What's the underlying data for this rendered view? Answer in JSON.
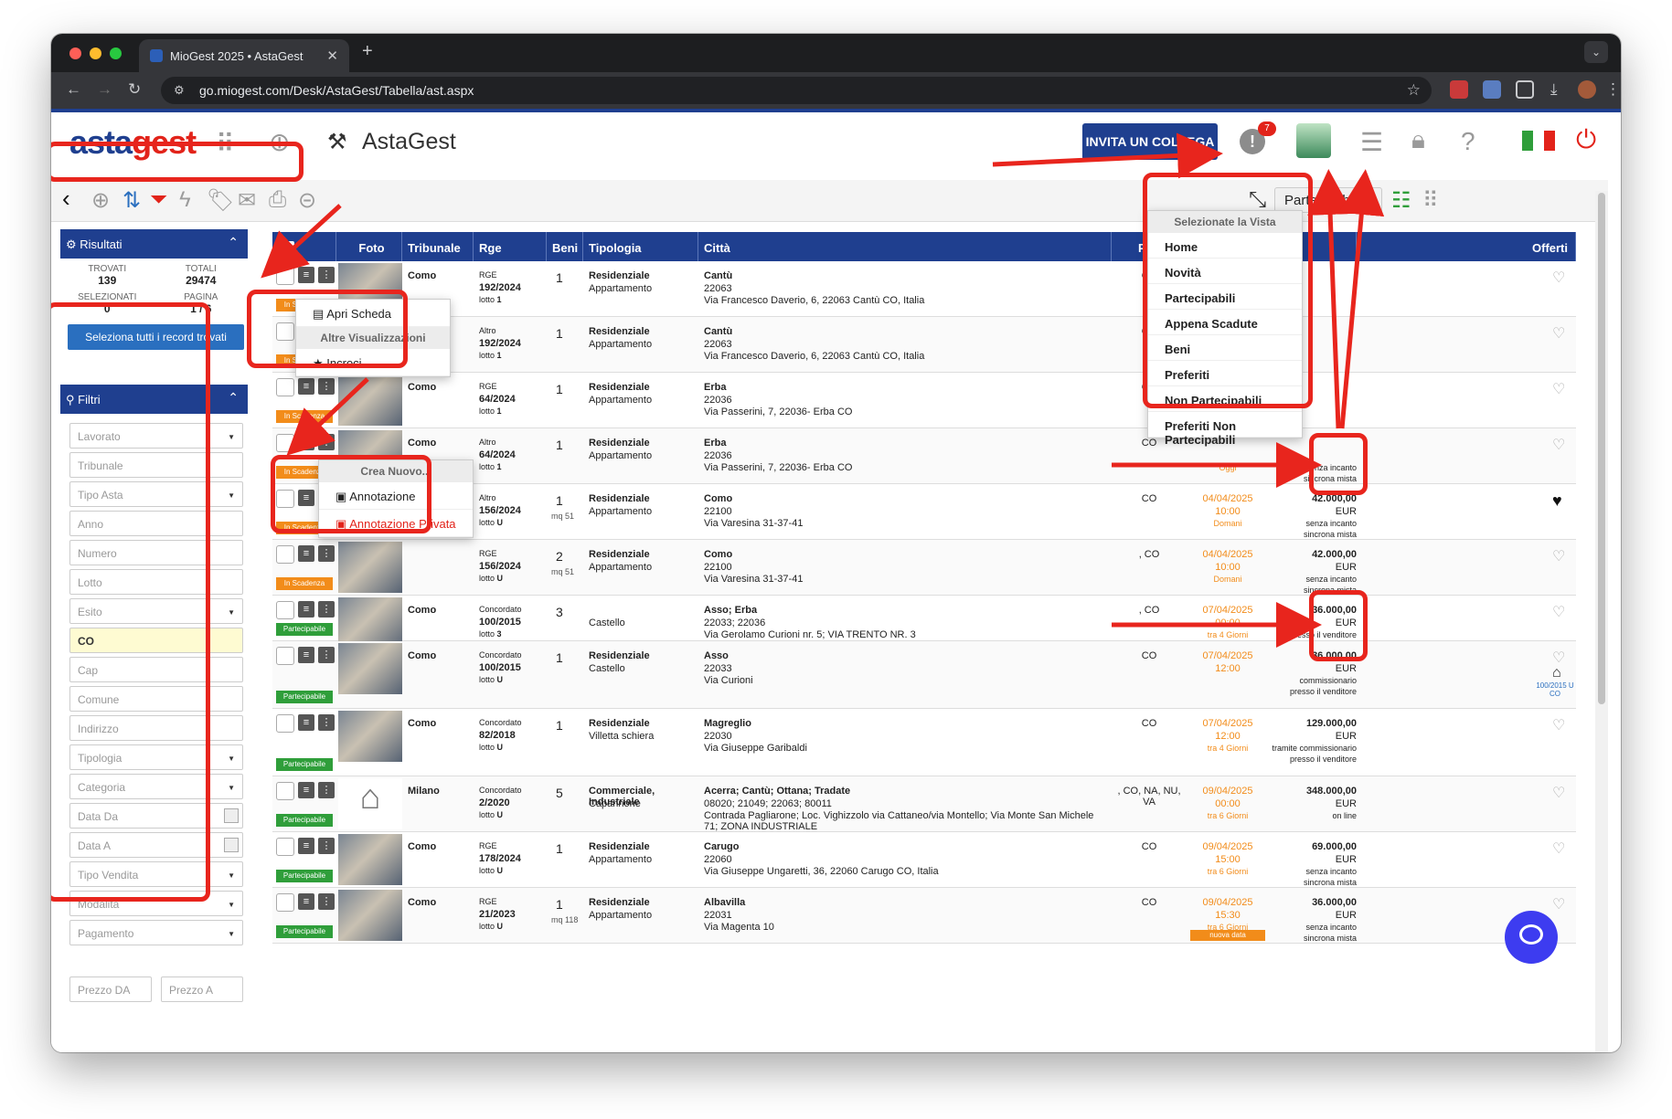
{
  "browser": {
    "tab_title": "MioGest 2025 • AstaGest",
    "url": "go.miogest.com/Desk/AstaGest/Tabella/ast.aspx"
  },
  "header": {
    "logo_part1": "asta",
    "logo_part2": "gest",
    "brand": "AstaGest",
    "invite_button": "INVITA UN COLLEGA",
    "alert_badge": "7"
  },
  "toolbar": {
    "view_selected": "Partecipabili"
  },
  "sidebar": {
    "results_title": "Risultati",
    "stats": [
      {
        "label": "TROVATI",
        "value": "139"
      },
      {
        "label": "TOTALI",
        "value": "29474"
      },
      {
        "label": "SELEZIONATI",
        "value": "0"
      },
      {
        "label": "PAGINA",
        "value": "1 / 6"
      }
    ],
    "select_all": "Seleziona tutti i record trovati",
    "filters_title": "Filtri",
    "filters": [
      "Lavorato",
      "Tribunale",
      "Tipo Asta",
      "Anno",
      "Numero",
      "Lotto",
      "Esito",
      "CO",
      "Cap",
      "Comune",
      "Indirizzo",
      "Tipologia",
      "Categoria",
      "Data Da",
      "Data A",
      "Tipo Vendita",
      "Modalità",
      "Pagamento"
    ],
    "price_from": "Prezzo DA",
    "price_to": "Prezzo A"
  },
  "table": {
    "headers": [
      "Foto",
      "Tribunale",
      "Rge",
      "Beni",
      "Tipologia",
      "Città",
      "Prov",
      "Offerti"
    ],
    "rows": [
      {
        "tag": "In Scadenza",
        "tribunale": "Como",
        "rge_type": "RGE",
        "rge": "192/2024",
        "lotto": "1",
        "beni": "1",
        "mq": "",
        "tip1": "Residenziale",
        "tip2": "Appartamento",
        "city": "Cantù",
        "cap": "22063",
        "addr": "Via Francesco Daverio, 6, 22063 Cantù CO, Italia",
        "prov": "CO",
        "date": "",
        "time": "",
        "when": "",
        "price": "",
        "curr": "",
        "m1": "",
        "m2": ""
      },
      {
        "tag": "In Scadenza",
        "tribunale": "Como",
        "rge_type": "Altro",
        "rge": "192/2024",
        "lotto": "1",
        "beni": "1",
        "mq": "",
        "tip1": "Residenziale",
        "tip2": "Appartamento",
        "city": "Cantù",
        "cap": "22063",
        "addr": "Via Francesco Daverio, 6, 22063 Cantù CO, Italia",
        "prov": "CO",
        "date": "",
        "time": "",
        "when": "",
        "price": "",
        "curr": "",
        "m1": "",
        "m2": ""
      },
      {
        "tag": "In Scadenza",
        "tribunale": "Como",
        "rge_type": "RGE",
        "rge": "64/2024",
        "lotto": "1",
        "beni": "1",
        "mq": "",
        "tip1": "Residenziale",
        "tip2": "Appartamento",
        "city": "Erba",
        "cap": "22036",
        "addr": "Via Passerini, 7, 22036- Erba CO",
        "prov": "CO",
        "date": "",
        "time": "",
        "when": "",
        "price": "",
        "curr": "",
        "m1": "",
        "m2": ""
      },
      {
        "tag": "In Scadenza",
        "tribunale": "Como",
        "rge_type": "Altro",
        "rge": "64/2024",
        "lotto": "1",
        "beni": "1",
        "mq": "",
        "tip1": "Residenziale",
        "tip2": "Appartamento",
        "city": "Erba",
        "cap": "22036",
        "addr": "Via Passerini, 7, 22036- Erba CO",
        "prov": "CO",
        "date": "",
        "time": "",
        "when": "Oggi",
        "price": "",
        "curr": "",
        "m1": "senza incanto",
        "m2": "sincrona mista"
      },
      {
        "tag": "In Scadenza",
        "tribunale": "Como",
        "rge_type": "Altro",
        "rge": "156/2024",
        "lotto": "U",
        "beni": "1",
        "mq": "mq 51",
        "tip1": "Residenziale",
        "tip2": "Appartamento",
        "city": "Como",
        "cap": "22100",
        "addr": "Via Varesina 31-37-41",
        "prov": "CO",
        "date": "04/04/2025",
        "time": "10:00",
        "when": "Domani",
        "price": "42.000,00",
        "curr": "EUR",
        "m1": "senza incanto",
        "m2": "sincrona mista"
      },
      {
        "tag": "In Scadenza",
        "tribunale": "",
        "rge_type": "RGE",
        "rge": "156/2024",
        "lotto": "U",
        "beni": "2",
        "mq": "mq 51",
        "tip1": "Residenziale",
        "tip2": "Appartamento",
        "city": "Como",
        "cap": "22100",
        "addr": "Via Varesina 31-37-41",
        "prov": ", CO",
        "date": "04/04/2025",
        "time": "10:00",
        "when": "Domani",
        "price": "42.000,00",
        "curr": "EUR",
        "m1": "senza incanto",
        "m2": "sincrona mista"
      },
      {
        "tag": "Partecipabile",
        "tribunale": "Como",
        "rge_type": "Concordato",
        "rge": "100/2015",
        "lotto": "3",
        "beni": "3",
        "mq": "",
        "tip1": "",
        "tip2": "Castello",
        "city": "Asso; Erba",
        "cap": "22033; 22036",
        "addr": "Via Gerolamo Curioni nr. 5; VIA TRENTO NR. 3",
        "prov": ", CO",
        "date": "07/04/2025",
        "time": "00:00",
        "when": "tra 4 Giorni",
        "price": "36.000,00",
        "curr": "EUR",
        "m1": "presso il venditore",
        "m2": ""
      },
      {
        "tag": "Partecipabile",
        "tribunale": "Como",
        "rge_type": "Concordato",
        "rge": "100/2015",
        "lotto": "U",
        "beni": "1",
        "mq": "",
        "tip1": "Residenziale",
        "tip2": "Castello",
        "city": "Asso",
        "cap": "22033",
        "addr": "Via Curioni",
        "prov": "CO",
        "date": "07/04/2025",
        "time": "12:00",
        "when": "",
        "price": "36.000,00",
        "curr": "EUR",
        "m1": "commissionario",
        "m2": "presso il venditore"
      },
      {
        "tag": "Partecipabile",
        "tribunale": "Como",
        "rge_type": "Concordato",
        "rge": "82/2018",
        "lotto": "U",
        "beni": "1",
        "mq": "",
        "tip1": "Residenziale",
        "tip2": "Villetta schiera",
        "city": "Magreglio",
        "cap": "22030",
        "addr": "Via Giuseppe Garibaldi",
        "prov": "CO",
        "date": "07/04/2025",
        "time": "12:00",
        "when": "tra 4 Giorni",
        "price": "129.000,00",
        "curr": "EUR",
        "m1": "tramite commissionario",
        "m2": "presso il venditore"
      },
      {
        "tag": "Partecipabile",
        "tribunale": "Milano",
        "rge_type": "Concordato",
        "rge": "2/2020",
        "lotto": "U",
        "beni": "5",
        "mq": "",
        "tip1": "Commerciale, Industriale",
        "tip2": "Capannone",
        "city": "Acerra; Cantù; Ottana; Tradate",
        "cap": "08020; 21049; 22063; 80011",
        "addr": "Contrada Pagliarone; Loc. Vighizzolo via Cattaneo/via Montello; Via Monte San Michele 71; ZONA INDUSTRIALE",
        "prov": ", CO, NA, NU, VA",
        "date": "09/04/2025",
        "time": "00:00",
        "when": "tra 6 Giorni",
        "price": "348.000,00",
        "curr": "EUR",
        "m1": "on line",
        "m2": ""
      },
      {
        "tag": "Partecipabile",
        "tribunale": "Como",
        "rge_type": "RGE",
        "rge": "178/2024",
        "lotto": "U",
        "beni": "1",
        "mq": "",
        "tip1": "Residenziale",
        "tip2": "Appartamento",
        "city": "Carugo",
        "cap": "22060",
        "addr": "Via Giuseppe Ungaretti, 36, 22060 Carugo CO, Italia",
        "prov": "CO",
        "date": "09/04/2025",
        "time": "15:00",
        "when": "tra 6 Giorni",
        "price": "69.000,00",
        "curr": "EUR",
        "m1": "senza incanto",
        "m2": "sincrona mista"
      },
      {
        "tag": "Partecipabile",
        "tribunale": "Como",
        "rge_type": "RGE",
        "rge": "21/2023",
        "lotto": "U",
        "beni": "1",
        "mq": "mq 118",
        "tip1": "Residenziale",
        "tip2": "Appartamento",
        "city": "Albavilla",
        "cap": "22031",
        "addr": "Via Magenta 10",
        "prov": "CO",
        "date": "09/04/2025",
        "time": "15:30",
        "when": "tra 6 Giorni",
        "price": "36.000,00",
        "curr": "EUR",
        "m1": "senza incanto",
        "m2": "sincrona mista"
      }
    ],
    "new_data_label": "nuova data",
    "ref_tag": "100/2015 U CO"
  },
  "context_menu_1": {
    "open": "Apri Scheda",
    "header": "Altre Visualizzazioni",
    "incroci": "Incroci"
  },
  "context_menu_2": {
    "header": "Crea Nuovo...",
    "annotation": "Annotazione",
    "private_annotation": "Annotazione Privata"
  },
  "view_menu": {
    "header": "Selezionate la Vista",
    "items": [
      "Home",
      "Novità",
      "Partecipabili",
      "Appena Scadute",
      "Beni",
      "Preferiti",
      "Non Partecipabili",
      "Preferiti Non Partecipabili"
    ]
  },
  "colors": {
    "primary": "#1f3f8f",
    "accent": "#e2231a",
    "orange": "#f28c1a",
    "green": "#2f9e3a",
    "annotation_red": "#e8251d"
  }
}
